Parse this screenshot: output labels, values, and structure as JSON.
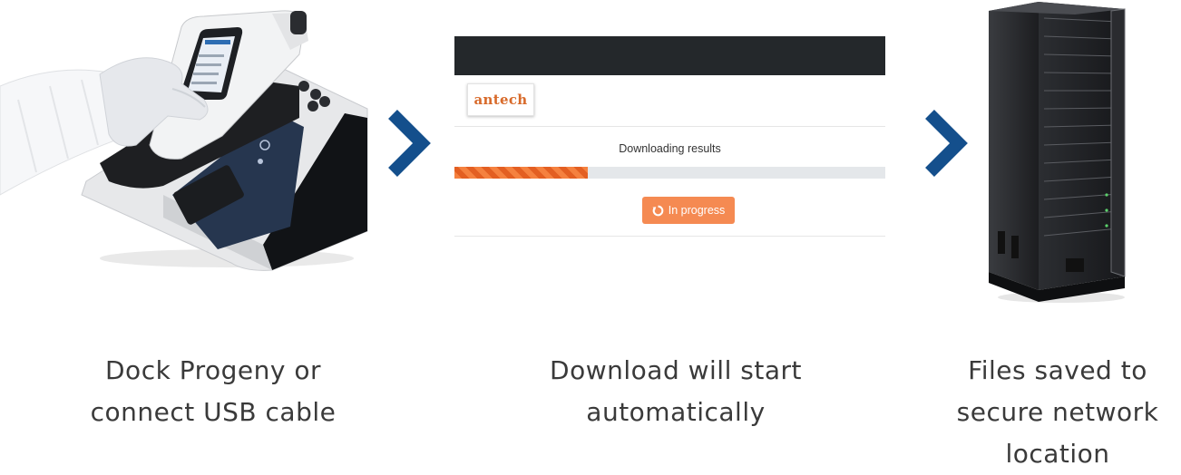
{
  "download_ui": {
    "logo_text": "antech",
    "status_text": "Downloading results",
    "progress_fraction": 0.31,
    "button_label": "In progress"
  },
  "steps": [
    {
      "caption_lines": [
        "Dock Progeny or",
        "connect USB cable"
      ]
    },
    {
      "caption_lines": [
        "Download will start",
        "automatically"
      ]
    },
    {
      "caption_lines": [
        "Files saved to",
        "secure network",
        "location"
      ]
    }
  ],
  "icons": {
    "arrow_1": "chevron-right-icon",
    "arrow_2": "chevron-right-icon",
    "spinner": "spinner-icon"
  },
  "colors": {
    "chevron": "#144f8c",
    "topbar": "#24282b",
    "brand_orange": "#f5813f",
    "button": "#f58a52"
  }
}
